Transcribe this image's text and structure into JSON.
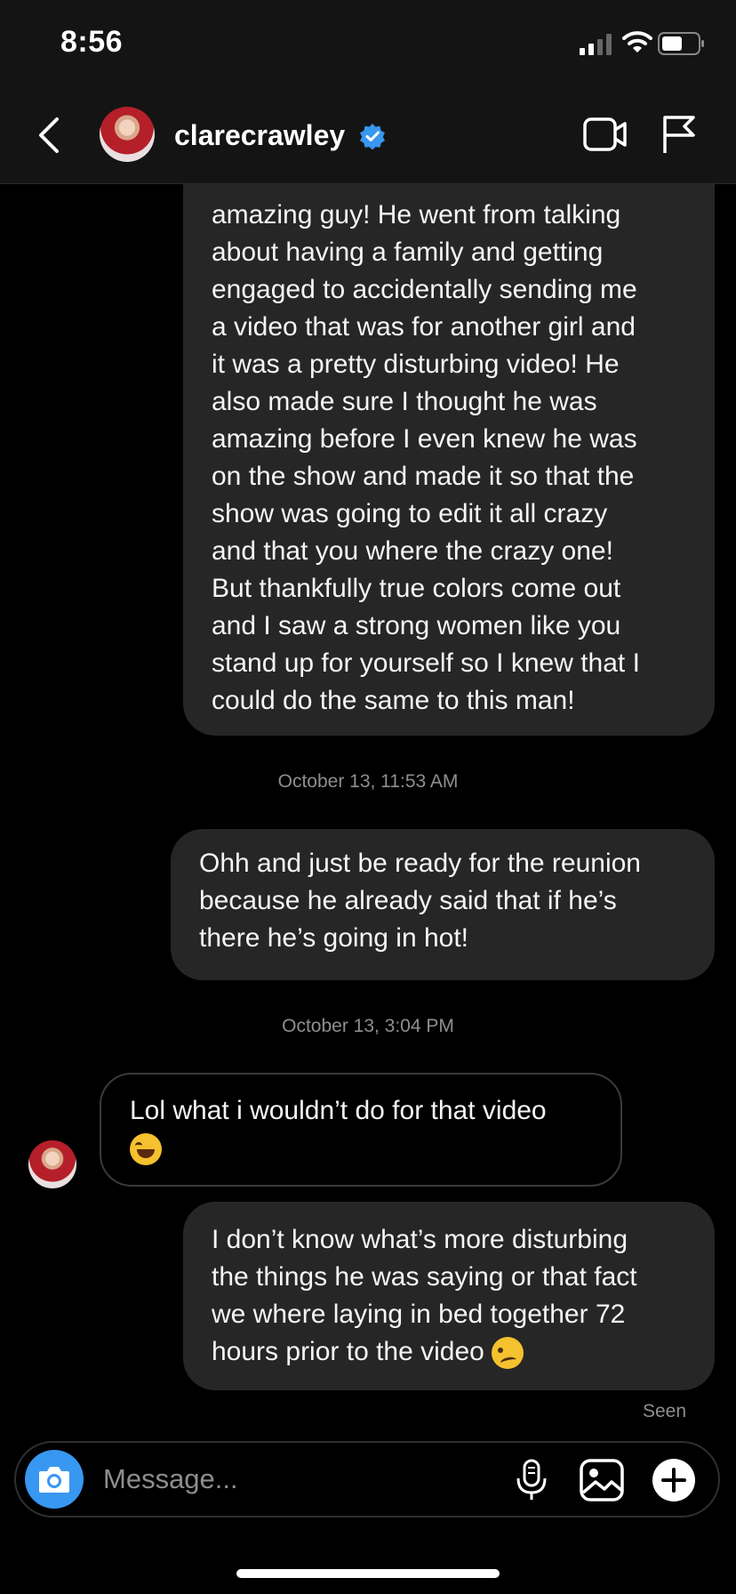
{
  "status_bar": {
    "time": "8:56",
    "icons": [
      "signal-icon",
      "wifi-icon",
      "battery-icon"
    ]
  },
  "header": {
    "back_icon": "chevron-left-icon",
    "contact_name": "clarecrawley",
    "verified_icon": "verified-badge-icon",
    "actions": [
      "video-call-icon",
      "flag-icon"
    ]
  },
  "messages": [
    {
      "sender": "me",
      "text": "amazing guy! He went from talking\nabout having a family and getting\nengaged to accidentally sending me\na video that was for another girl and\nit was a pretty disturbing video! He\nalso made sure I thought he was\namazing before I even knew he was\non the show and made it so that the\nshow was going to edit it all crazy\nand that you where the crazy one!\nBut thankfully true colors come out\nand I saw a strong women like you\nstand up for yourself so I knew that I\ncould do the same to this man!"
    },
    {
      "type": "timestamp",
      "text": "October 13, 11:53 AM"
    },
    {
      "sender": "me",
      "text": "Ohh and just be ready for the reunion\nbecause he already said that if he’s\nthere he’s going in hot!"
    },
    {
      "type": "timestamp",
      "text": "October 13, 3:04 PM"
    },
    {
      "sender": "clarecrawley",
      "text": "Lol what i wouldn’t do for that video",
      "emoji": "face-with-tears-of-joy-icon"
    },
    {
      "sender": "me",
      "text": "I don’t know what’s more disturbing\nthe things he was saying or that fact\nwe where laying in bed together 72\nhours prior to the video ",
      "emoji": "woozy-face-icon"
    }
  ],
  "seen_label": "Seen",
  "composer": {
    "placeholder": "Message...",
    "icons": [
      "camera-icon",
      "microphone-icon",
      "gallery-icon",
      "plus-icon"
    ]
  },
  "colors": {
    "background": "#000000",
    "bubble": "#262626",
    "accent": "#3897f0",
    "muted_text": "#8e8e8e"
  }
}
